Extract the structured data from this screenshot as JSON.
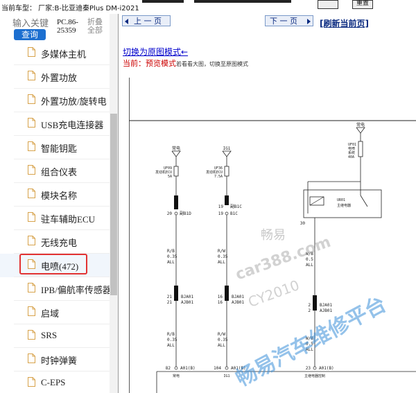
{
  "topbar": {
    "model_text": "当前车型： 厂家:B-比亚迪秦Plus DM-i2021",
    "btn_left": "",
    "btn_right": "重置"
  },
  "sidebar": {
    "search_placeholder": "输入关键",
    "search_button": "查询",
    "pc_code_line1": "PC.86-",
    "pc_code_line2": "25359",
    "collapse_line1": "折叠",
    "collapse_line2": "全部",
    "items": [
      "多媒体主机",
      "外置功放",
      "外置功放/旋转电",
      "USB充电连接器",
      "智能钥匙",
      "组合仪表",
      "模块名称",
      "驻车辅助ECU",
      "无线充电",
      "电喷(472)",
      "IPB/偏航率传感器",
      "启域",
      "SRS",
      "时钟弹簧",
      "C-EPS"
    ],
    "selected_index": 9
  },
  "main": {
    "prev_label": "上 一 页",
    "next_label": "下 一 页",
    "refresh_label": "[刷新当前页]",
    "mode_link": "切换为原图模式←",
    "mode_status_prefix": "当前：",
    "mode_status_value": "预览模式",
    "mode_status_hint": "若看看大图，切换至原图模式"
  },
  "diagram": {
    "col1_power": "常电",
    "col1_fuse_label": "UF09",
    "col1_fuse_desc": "发动机ECU",
    "col1_fuse_rating": "5A",
    "col1_pin_top": "20",
    "col1_conn_top": "副B1D",
    "col1_wire1": "R/B",
    "col1_wire1_size": "0.35",
    "col1_wire1_all": "ALL",
    "col1_joint_a": "21",
    "col1_joint_b": "21",
    "col1_joint_name_a": "BJA01",
    "col1_joint_name_b": "AJB01",
    "col1_wire2": "R/B",
    "col1_wire2_size": "0.35",
    "col1_wire2_all": "ALL",
    "col1_pin_bottom": "82",
    "col1_label_bottom": "常电",
    "col2_power": "IG1",
    "col2_fuse_label": "UF36",
    "col2_fuse_desc": "发动机ECU",
    "col2_fuse_rating": "7.5A",
    "col2_pin_top": "19",
    "col2_conn_top": "副B1C",
    "col2_pin_top2": "19",
    "col2_conn_top2": "B1C",
    "col2_wire1": "R/W",
    "col2_wire1_size": "0.35",
    "col2_wire1_all": "ALL",
    "col2_joint_a": "16",
    "col2_joint_b": "16",
    "col2_joint_name_a": "BJA01",
    "col2_joint_name_b": "AJB01",
    "col2_wire2": "R/W",
    "col2_wire2_size": "0.35",
    "col2_wire2_all": "ALL",
    "col2_pin_bottom": "104",
    "col2_label_bottom": "IG1",
    "col3_power": "常电",
    "col3_fuse_label": "UF01",
    "col3_fuse_desc": "电喷",
    "col3_fuse_desc2": "系统",
    "col3_fuse_rating": "40A",
    "col3_relay": "UR01",
    "col3_relay_desc": "主继电器",
    "col3_wire": "W/B",
    "col3_wire_size": "0.5",
    "col3_wire_all": "ALL",
    "col3_joint_a": "2",
    "col3_joint_b": "2",
    "col3_joint_name_a": "BJA01",
    "col3_joint_name_b": "AJB01",
    "col3_wire2": "W/B",
    "col3_wire2_size": "0.5",
    "col3_wire2_all": "ALL",
    "col3_pin_bottom": "23",
    "col3_label_bottom": "主继电器控制",
    "conn_bottom": "A01(B)",
    "watermark_1": "畅易",
    "watermark_2": "car388.com",
    "watermark_3": "CY2010",
    "watermark_4": "畅易汽车维修平台"
  }
}
